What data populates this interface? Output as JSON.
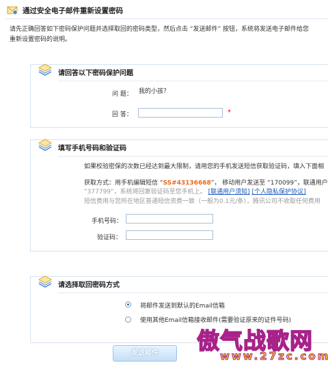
{
  "header": {
    "title": "通过安全电子邮件重新设置密码",
    "intro_line1": "请先正确回答如下密码保护问题并选择取回的密码类型，然后点击 “发送邮件” 按钮，系统将发送电子邮件给您",
    "intro_line2": "重新设置密码的说明。"
  },
  "section_question": {
    "title": "请回答以下密码保护问题",
    "question_label": "问  题：",
    "question_value": "我的小孩？",
    "answer_label": "回  答：",
    "answer_value": "",
    "required_mark": "*"
  },
  "section_phone": {
    "title": "填写手机号码和验证码",
    "notice": "如果校验密保的次数已经达到最大限制，请用您的手机发送短信获取验证码，填入下面相",
    "method_prefix": "获取方式：用手机编辑短信 “",
    "sms_code": "SS#43136668",
    "method_mid": "”， 移动用户发送至 “170099”，联通用户",
    "method_line2": "“377799”，系统将回复验证码至您手机上。",
    "link_unicom": "[联通用户须知]",
    "link_privacy": "[个人隐私保护协议]",
    "fee_note": "短信费用与您所在地区普通短信资费一致（一般为0.1元/条），腾讯公司不收取任何费用",
    "phone_label": "手机号码：",
    "phone_value": "",
    "code_label": "验证码：",
    "code_value": ""
  },
  "section_method": {
    "title": "请选择取回密码方式",
    "option_default": "将邮件发送到默认的Email信箱",
    "option_other": "使用其他Email信箱接收邮件(需要验证原来的证件号码)"
  },
  "actions": {
    "send_label": "发送邮件"
  },
  "watermark": {
    "title": "傲气战歌网",
    "url": "www.27zc.com"
  },
  "colors": {
    "accent": "#1b58b8",
    "sms_code": "#e86a1b",
    "required": "#ee0000"
  }
}
